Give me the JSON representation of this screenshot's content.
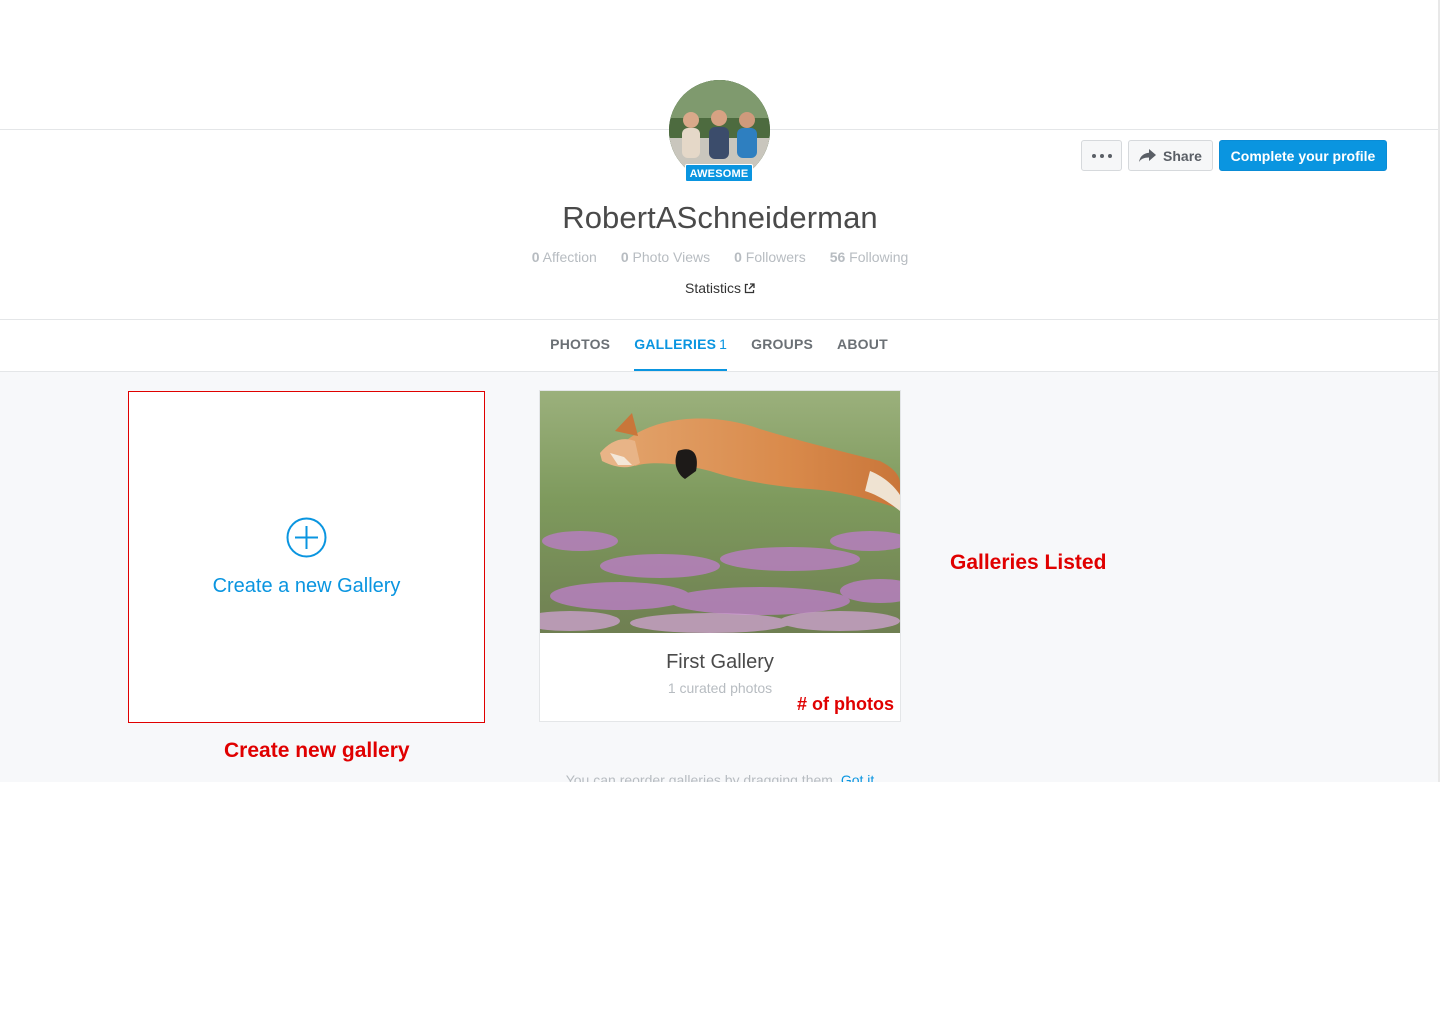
{
  "profile": {
    "username": "RobertASchneiderman",
    "badge": "AWESOME",
    "stats": [
      {
        "value": "0",
        "label": "Affection"
      },
      {
        "value": "0",
        "label": "Photo Views"
      },
      {
        "value": "0",
        "label": "Followers"
      },
      {
        "value": "56",
        "label": "Following"
      }
    ],
    "statistics_link": "Statistics"
  },
  "actions": {
    "more_icon": "ellipsis-icon",
    "share_label": "Share",
    "share_icon": "share-arrow-icon",
    "complete_label": "Complete your profile"
  },
  "tabs": [
    {
      "label": "PHOTOS",
      "count": "",
      "active": false
    },
    {
      "label": "GALLERIES",
      "count": "1",
      "active": true
    },
    {
      "label": "GROUPS",
      "count": "",
      "active": false
    },
    {
      "label": "ABOUT",
      "count": "",
      "active": false
    }
  ],
  "galleries": {
    "create_label": "Create a new Gallery",
    "create_icon": "plus-circle-icon",
    "items": [
      {
        "title": "First Gallery",
        "subtitle": "1 curated photos"
      }
    ],
    "hint": "You can reorder galleries by dragging them.",
    "hint_action": "Got it"
  },
  "annotations": {
    "photos": "# of photos",
    "galleries": "Galleries Listed",
    "create": "Create new gallery"
  },
  "colors": {
    "accent": "#0a95e0",
    "annotation": "#e00000",
    "content_bg": "#f7f8fa"
  }
}
